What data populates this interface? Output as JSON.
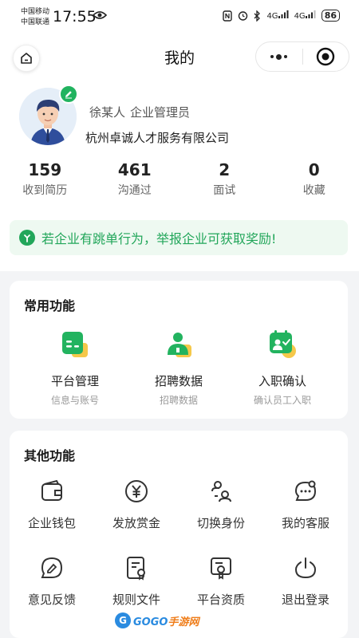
{
  "status_bar": {
    "carrier_1": "中国移动",
    "carrier_2": "中国联通",
    "time": "17:55",
    "network_1": "4G",
    "network_2": "4G",
    "battery": "86"
  },
  "nav": {
    "title": "我的"
  },
  "profile": {
    "name": "徐某人",
    "role": "企业管理员",
    "company": "杭州卓诚人才服务有限公司"
  },
  "stats": [
    {
      "value": "159",
      "label": "收到简历"
    },
    {
      "value": "461",
      "label": "沟通过"
    },
    {
      "value": "2",
      "label": "面试"
    },
    {
      "value": "0",
      "label": "收藏"
    }
  ],
  "notice": {
    "text": "若企业有跳单行为，举报企业可获取奖励!"
  },
  "common_functions": {
    "title": "常用功能",
    "items": [
      {
        "label": "平台管理",
        "sub": "信息与账号",
        "icon": "id-card-icon"
      },
      {
        "label": "招聘数据",
        "sub": "招聘数据",
        "icon": "person-data-icon"
      },
      {
        "label": "入职确认",
        "sub": "确认员工入职",
        "icon": "onboard-confirm-icon"
      }
    ]
  },
  "other_functions": {
    "title": "其他功能",
    "items": [
      {
        "label": "企业钱包",
        "icon": "wallet-icon"
      },
      {
        "label": "发放赏金",
        "icon": "yen-icon"
      },
      {
        "label": "切换身份",
        "icon": "switch-identity-icon"
      },
      {
        "label": "我的客服",
        "icon": "customer-service-icon"
      },
      {
        "label": "意见反馈",
        "icon": "feedback-icon"
      },
      {
        "label": "规则文件",
        "icon": "rules-document-icon"
      },
      {
        "label": "平台资质",
        "icon": "qualification-icon"
      },
      {
        "label": "退出登录",
        "icon": "power-icon"
      }
    ]
  },
  "watermark": {
    "brand": "GOGO",
    "suffix": "手游网"
  },
  "colors": {
    "accent": "#22a65a",
    "accent_light": "#eef9f1",
    "icon_yellow": "#f5c84a",
    "background": "#f3f4f6"
  }
}
